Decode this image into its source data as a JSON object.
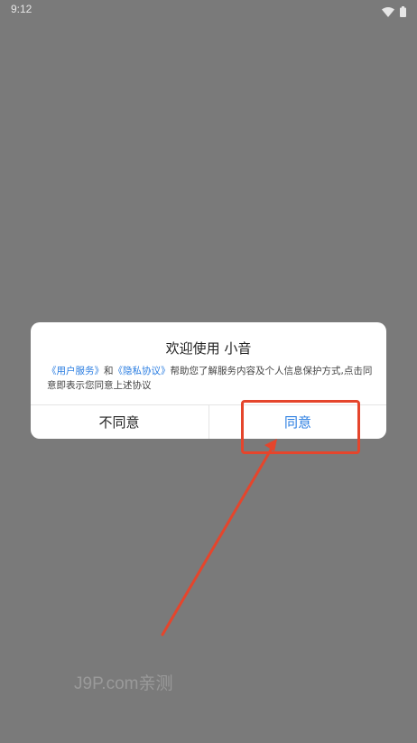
{
  "status_bar": {
    "time": "9:12",
    "icons": [
      "wifi-icon",
      "battery-icon"
    ]
  },
  "dialog": {
    "title": "欢迎使用 小音",
    "body": {
      "link_user_service": "《用户服务》",
      "connector": "和",
      "link_privacy": "《隐私协议》",
      "text_rest": "帮助您了解服务内容及个人信息保护方式,点击同意即表示您同意上述协议"
    },
    "buttons": {
      "disagree": "不同意",
      "agree": "同意"
    }
  },
  "annotation": {
    "color": "#e5452c"
  },
  "watermark": "J9P.com亲测",
  "colors": {
    "overlay": "#7a7a7a",
    "link": "#2a7de1",
    "highlight": "#e5452c"
  }
}
